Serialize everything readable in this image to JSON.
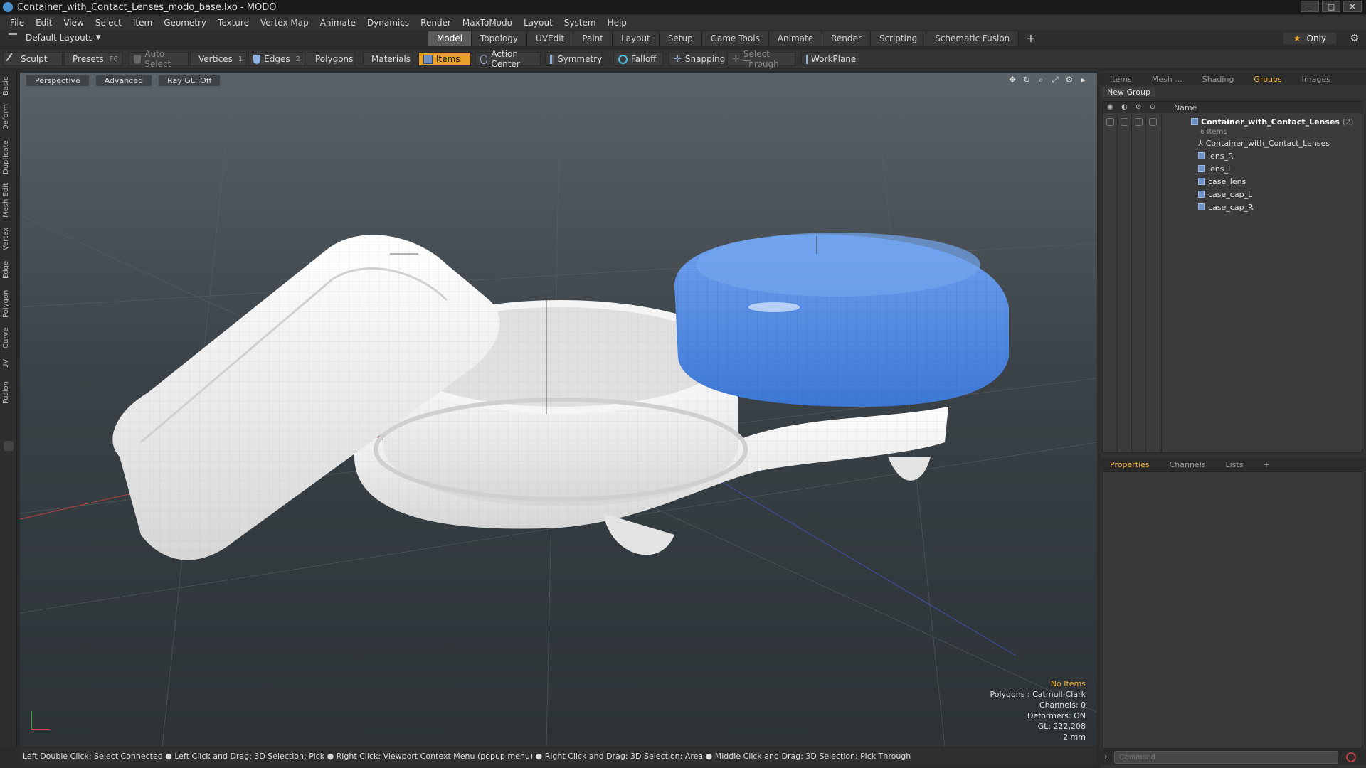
{
  "window": {
    "title": "Container_with_Contact_Lenses_modo_base.lxo - MODO"
  },
  "menu": [
    "File",
    "Edit",
    "View",
    "Select",
    "Item",
    "Geometry",
    "Texture",
    "Vertex Map",
    "Animate",
    "Dynamics",
    "Render",
    "MaxToModo",
    "Layout",
    "System",
    "Help"
  ],
  "layouts": {
    "label": "Default Layouts"
  },
  "tabs": [
    "Model",
    "Topology",
    "UVEdit",
    "Paint",
    "Layout",
    "Setup",
    "Game Tools",
    "Animate",
    "Render",
    "Scripting",
    "Schematic Fusion"
  ],
  "active_tab": "Model",
  "only_label": "Only",
  "toolbar": {
    "sculpt": "Sculpt",
    "presets": "Presets",
    "presets_key": "F6",
    "auto_select": "Auto Select",
    "vertices": "Vertices",
    "vertices_count": "1",
    "edges": "Edges",
    "edges_count": "2",
    "polygons": "Polygons",
    "materials": "Materials",
    "items": "Items",
    "action_center": "Action Center",
    "symmetry": "Symmetry",
    "falloff": "Falloff",
    "snapping": "Snapping",
    "select_through": "Select Through",
    "workplane": "WorkPlane"
  },
  "left_tabs": [
    "Basic",
    "Deform",
    "Duplicate",
    "Mesh Edit",
    "Vertex",
    "Edge",
    "Polygon",
    "Curve",
    "UV",
    "Fusion"
  ],
  "viewport": {
    "view": "Perspective",
    "shading": "Advanced",
    "raygl": "Ray GL: Off",
    "info": {
      "selection": "No Items",
      "polygons": "Polygons : Catmull-Clark",
      "channels": "Channels: 0",
      "deformers": "Deformers: ON",
      "gl": "GL: 222,208",
      "unit": "2 mm"
    }
  },
  "status": "Left Double Click: Select Connected ● Left Click and Drag: 3D Selection: Pick ● Right Click: Viewport Context Menu (popup menu) ● Right Click and Drag: 3D Selection: Area ● Middle Click and Drag: 3D Selection: Pick Through",
  "panel": {
    "tabs": [
      "Items",
      "Mesh ...",
      "Shading",
      "Groups",
      "Images"
    ],
    "active_tab": "Groups",
    "new_group": "New Group",
    "col_name": "Name",
    "group": {
      "name": "Container_with_Contact_Lenses",
      "count": "(2)",
      "sub": "6 Items"
    },
    "items": [
      "Container_with_Contact_Lenses",
      "lens_R",
      "lens_L",
      "case_lens",
      "case_cap_L",
      "case_cap_R"
    ],
    "bottom_tabs": [
      "Properties",
      "Channels",
      "Lists"
    ],
    "bottom_active": "Properties"
  },
  "command": {
    "placeholder": "Command"
  },
  "colors": {
    "accent": "#e7a12a",
    "cap_blue": "#4a86e0",
    "plastic": "#f2f2f2"
  }
}
